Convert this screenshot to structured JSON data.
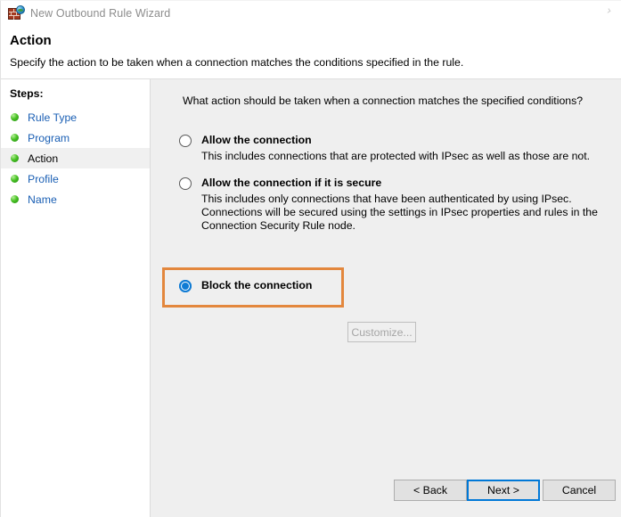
{
  "window": {
    "title": "New Outbound Rule Wizard",
    "icon": "firewall-brick-globe-icon",
    "chevron": "›"
  },
  "header": {
    "title": "Action",
    "subtitle": "Specify the action to be taken when a connection matches the conditions specified in the rule."
  },
  "sidebar": {
    "heading": "Steps:",
    "items": [
      {
        "label": "Rule Type",
        "current": false
      },
      {
        "label": "Program",
        "current": false
      },
      {
        "label": "Action",
        "current": true
      },
      {
        "label": "Profile",
        "current": false
      },
      {
        "label": "Name",
        "current": false
      }
    ]
  },
  "main": {
    "question": "What action should be taken when a connection matches the specified conditions?",
    "options": [
      {
        "title": "Allow the connection",
        "description": "This includes connections that are protected with IPsec as well as those are not.",
        "selected": false
      },
      {
        "title": "Allow the connection if it is secure",
        "description": "This includes only connections that have been authenticated by using IPsec.  Connections will be secured using the settings in IPsec properties and rules in the Connection Security Rule node.",
        "selected": false
      },
      {
        "title": "Block the connection",
        "description": "",
        "selected": true
      }
    ],
    "customize_button": {
      "label": "Customize...",
      "enabled": false
    }
  },
  "footer": {
    "back_label": "< Back",
    "next_label": "Next >",
    "cancel_label": "Cancel"
  },
  "annotation": {
    "target": "Block the connection",
    "color": "#e3873d"
  },
  "colors": {
    "accent": "#0078d7",
    "link": "#1a5fb4",
    "panel": "#efefef",
    "highlight": "#e3873d",
    "step_bullet": "#49c124"
  }
}
